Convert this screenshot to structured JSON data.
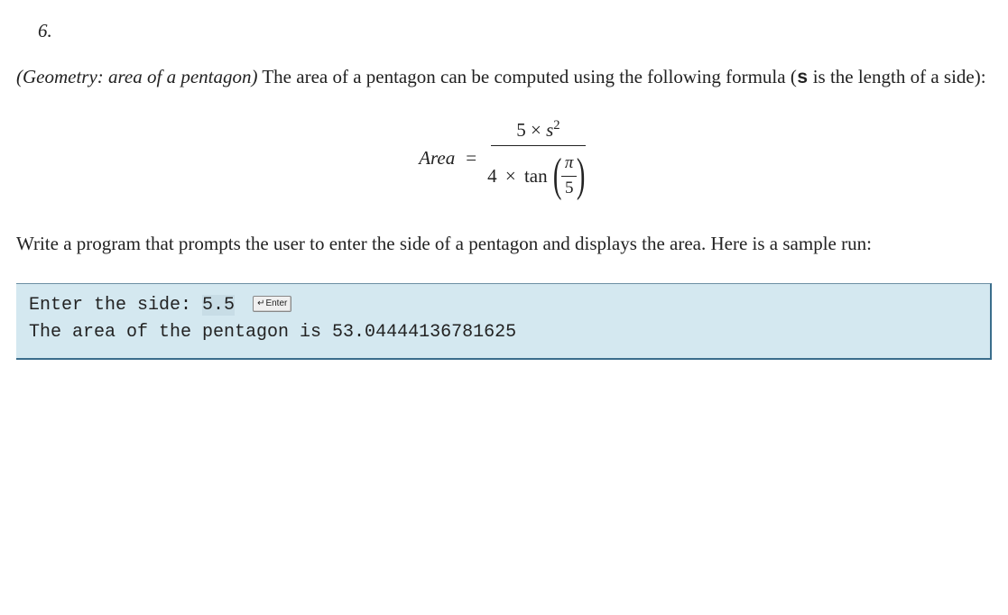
{
  "problem": {
    "number": "6.",
    "title_italic": "(Geometry: area of a pentagon)",
    "intro_part1": " The area of a pentagon can be computed using the following formula (",
    "intro_var": "s",
    "intro_part2": " is the length of a side):",
    "instruction": "Write a program that prompts the user to enter the side of a pentagon and displays the area. Here is a sample run:"
  },
  "formula": {
    "lhs": "Area",
    "equals": "=",
    "numerator_5": "5",
    "times": "×",
    "var_s": "s",
    "exponent": "2",
    "denom_4": "4",
    "tan": "tan",
    "pi": "π",
    "five": "5"
  },
  "sample": {
    "prompt": "Enter the side: ",
    "input_value": "5.5",
    "enter_label": "Enter",
    "output": "The area of the pentagon is 53.04444136781625"
  }
}
